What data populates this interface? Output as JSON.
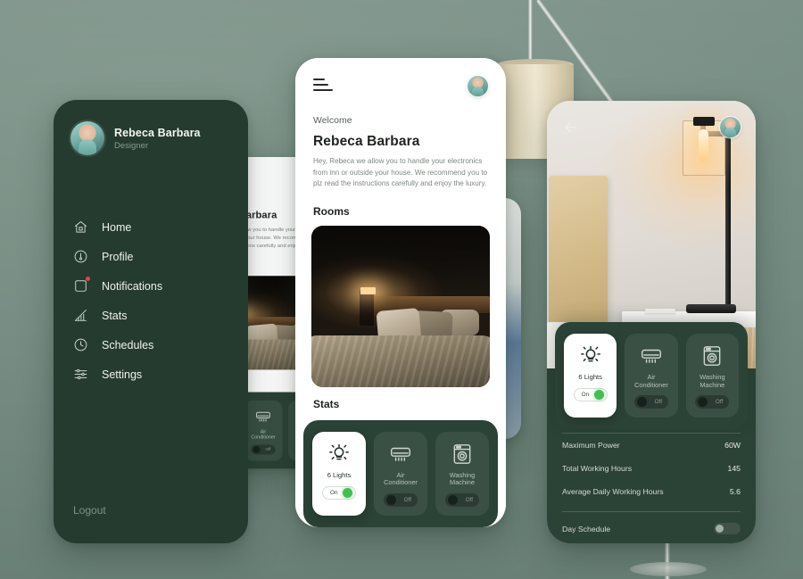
{
  "scene": {
    "background_color": "#7d948a",
    "prop": "floor-lamp"
  },
  "sidebar": {
    "panel_color": "#253b2f",
    "user": {
      "name": "Rebeca Barbara",
      "role": "Designer",
      "avatar": "user-avatar"
    },
    "items": [
      {
        "label": "Home",
        "icon": "home-icon",
        "badge": false
      },
      {
        "label": "Profile",
        "icon": "person-icon",
        "badge": false
      },
      {
        "label": "Notifications",
        "icon": "notification-icon",
        "badge": true
      },
      {
        "label": "Stats",
        "icon": "chart-icon",
        "badge": false
      },
      {
        "label": "Schedules",
        "icon": "clock-icon",
        "badge": false
      },
      {
        "label": "Settings",
        "icon": "sliders-icon",
        "badge": false
      }
    ],
    "logout_label": "Logout"
  },
  "home": {
    "menu_icon": "hamburger-icon",
    "avatar": "user-avatar",
    "welcome": "Welcome",
    "name": "Rebeca Barbara",
    "intro": "Hey, Rebeca we allow you to handle your electronics from inn or outside your house. We recommend you to plz read the instructions carefully and enjoy the luxury.",
    "rooms_title": "Rooms",
    "room_image": "bedroom-night-photo",
    "stats_title": "Stats",
    "devices": [
      {
        "name": "6 Lights",
        "icon": "lightbulb-icon",
        "state": "On",
        "on": true
      },
      {
        "name": "Air Conditioner",
        "icon": "air-conditioner-icon",
        "state": "Off",
        "on": false
      },
      {
        "name": "Washing Machine",
        "icon": "washing-machine-icon",
        "state": "Off",
        "on": false
      }
    ]
  },
  "detail": {
    "back_icon": "back-arrow-icon",
    "avatar": "user-avatar",
    "photo": "bedside-lamp-photo",
    "devices": [
      {
        "name": "6 Lights",
        "icon": "lightbulb-icon",
        "state": "On",
        "on": true
      },
      {
        "name": "Air Conditioner",
        "icon": "air-conditioner-icon",
        "state": "Off",
        "on": false
      },
      {
        "name": "Washing Machine",
        "icon": "washing-machine-icon",
        "state": "Off",
        "on": false
      }
    ],
    "stats": [
      {
        "label": "Maximum Power",
        "value": "60W"
      },
      {
        "label": "Total Working Hours",
        "value": "145"
      },
      {
        "label": "Average Daily Working Hours",
        "value": "5.6"
      }
    ],
    "schedule": {
      "label": "Day Schedule",
      "on": false
    }
  }
}
